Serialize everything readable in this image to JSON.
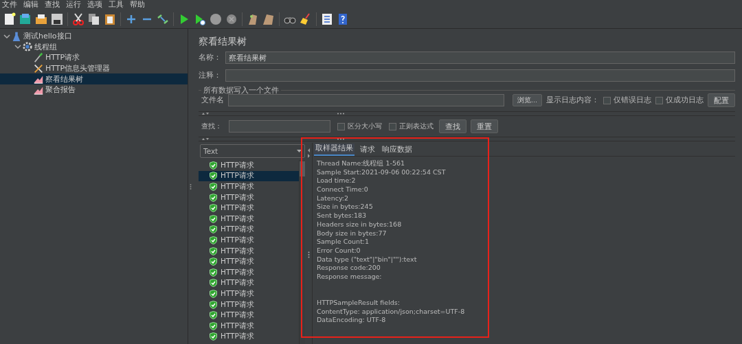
{
  "menu": [
    "文件",
    "编辑",
    "查找",
    "运行",
    "选项",
    "工具",
    "帮助"
  ],
  "tree": [
    {
      "label": "测试hello接口",
      "kind": "plan",
      "expanded": true,
      "selected": false,
      "children": [
        {
          "label": "线程组",
          "kind": "threads",
          "expanded": true,
          "selected": false,
          "children": [
            {
              "label": "HTTP请求",
              "kind": "sampler",
              "selected": false
            },
            {
              "label": "HTTP信息头管理器",
              "kind": "config",
              "selected": false
            },
            {
              "label": "察看结果树",
              "kind": "listener",
              "selected": true
            },
            {
              "label": "聚合报告",
              "kind": "listener",
              "selected": false
            }
          ]
        }
      ]
    }
  ],
  "panel": {
    "title": "察看结果树",
    "name_label": "名称：",
    "name_value": "察看结果树",
    "comment_label": "注释：",
    "file_section": "所有数据写入一个文件",
    "file_label": "文件名",
    "browse_button": "浏览...",
    "log_label": "显示日志内容：",
    "log_options": [
      {
        "label": "仅错误日志",
        "checked": false
      },
      {
        "label": "仅成功日志",
        "checked": false
      }
    ],
    "config_button": "配置",
    "search_label": "查找：",
    "search_options": [
      {
        "label": "区分大小写",
        "checked": false
      },
      {
        "label": "正则表达式",
        "checked": false
      }
    ],
    "search_buttons": [
      "查找",
      "重置"
    ]
  },
  "renderer": "Text",
  "results": [
    {
      "label": "HTTP请求",
      "selected": false
    },
    {
      "label": "HTTP请求",
      "selected": true
    },
    {
      "label": "HTTP请求",
      "selected": false
    },
    {
      "label": "HTTP请求",
      "selected": false
    },
    {
      "label": "HTTP请求",
      "selected": false
    },
    {
      "label": "HTTP请求",
      "selected": false
    },
    {
      "label": "HTTP请求",
      "selected": false
    },
    {
      "label": "HTTP请求",
      "selected": false
    },
    {
      "label": "HTTP请求",
      "selected": false
    },
    {
      "label": "HTTP请求",
      "selected": false
    },
    {
      "label": "HTTP请求",
      "selected": false
    },
    {
      "label": "HTTP请求",
      "selected": false
    },
    {
      "label": "HTTP请求",
      "selected": false
    },
    {
      "label": "HTTP请求",
      "selected": false
    },
    {
      "label": "HTTP请求",
      "selected": false
    },
    {
      "label": "HTTP请求",
      "selected": false
    },
    {
      "label": "HTTP请求",
      "selected": false
    }
  ],
  "tabs": [
    {
      "label": "取样器结果",
      "selected": true
    },
    {
      "label": "请求",
      "selected": false
    },
    {
      "label": "响应数据",
      "selected": false
    }
  ],
  "details": [
    "Thread Name:线程组 1-561",
    "Sample Start:2021-09-06 00:22:54 CST",
    "Load time:2",
    "Connect Time:0",
    "Latency:2",
    "Size in bytes:245",
    "Sent bytes:183",
    "Headers size in bytes:168",
    "Body size in bytes:77",
    "Sample Count:1",
    "Error Count:0",
    "Data type (\"text\"|\"bin\"|\"\"):text",
    "Response code:200",
    "Response message:"
  ],
  "result_fields": [
    "HTTPSampleResult fields:",
    "ContentType: application/json;charset=UTF-8",
    "DataEncoding: UTF-8"
  ],
  "annotation": {
    "kind": "frame"
  }
}
